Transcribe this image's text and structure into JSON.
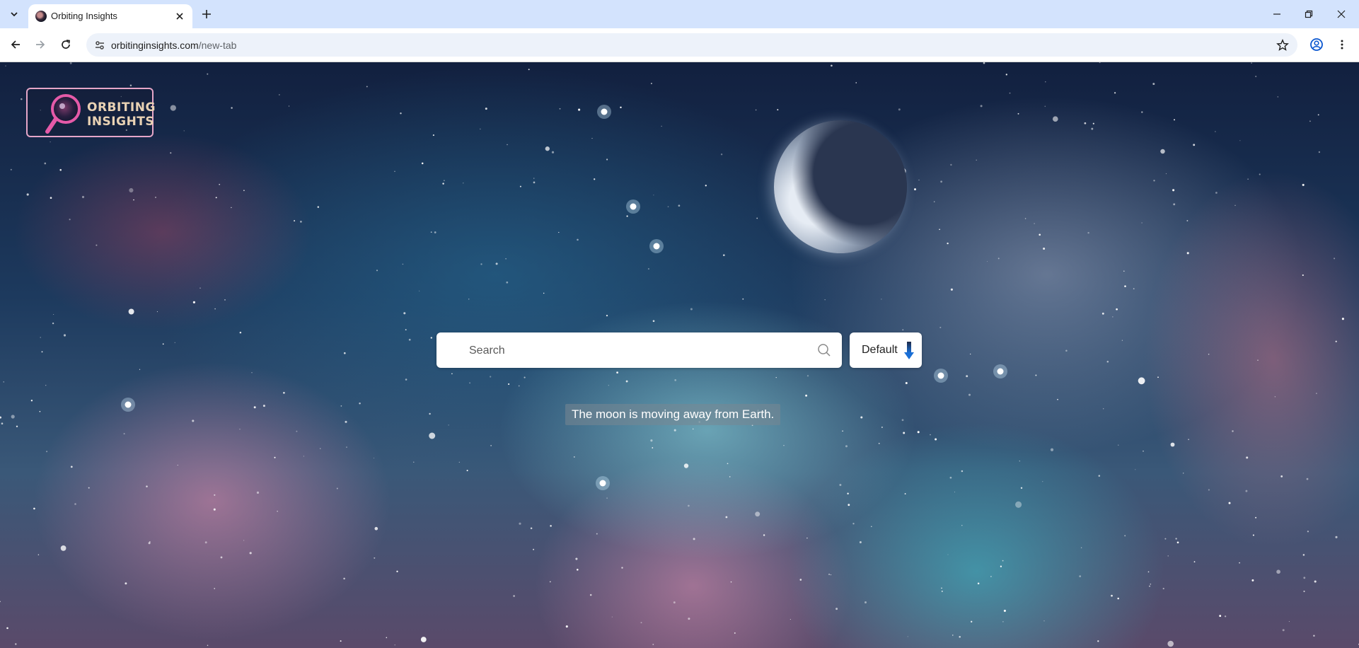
{
  "browser": {
    "tab": {
      "title": "Orbiting Insights"
    },
    "url": {
      "host": "orbitinginsights.com",
      "path": "/new-tab"
    }
  },
  "logo": {
    "line1": "ORBITING",
    "line2": "INSIGHTS"
  },
  "search": {
    "placeholder": "Search",
    "value": ""
  },
  "engine": {
    "selected": "Default"
  },
  "fact": {
    "text": "The moon is moving away from Earth."
  },
  "colors": {
    "tab_strip": "#d3e3fd",
    "omnibox": "#edf2fa",
    "logo_border": "#e5a6c8",
    "logo_text": "#e9d2b4",
    "dropdown_arrow": "#1a6fd6"
  },
  "icons": {
    "tab_search": "chevron-down-icon",
    "tab_close": "close-icon",
    "new_tab": "plus-icon",
    "back": "arrow-left-icon",
    "forward": "arrow-right-icon",
    "reload": "reload-icon",
    "site_info": "tune-icon",
    "bookmark": "star-icon",
    "profile": "account-icon",
    "menu": "kebab-menu-icon",
    "search": "magnifier-icon",
    "engine_dropdown": "arrow-down-icon"
  }
}
